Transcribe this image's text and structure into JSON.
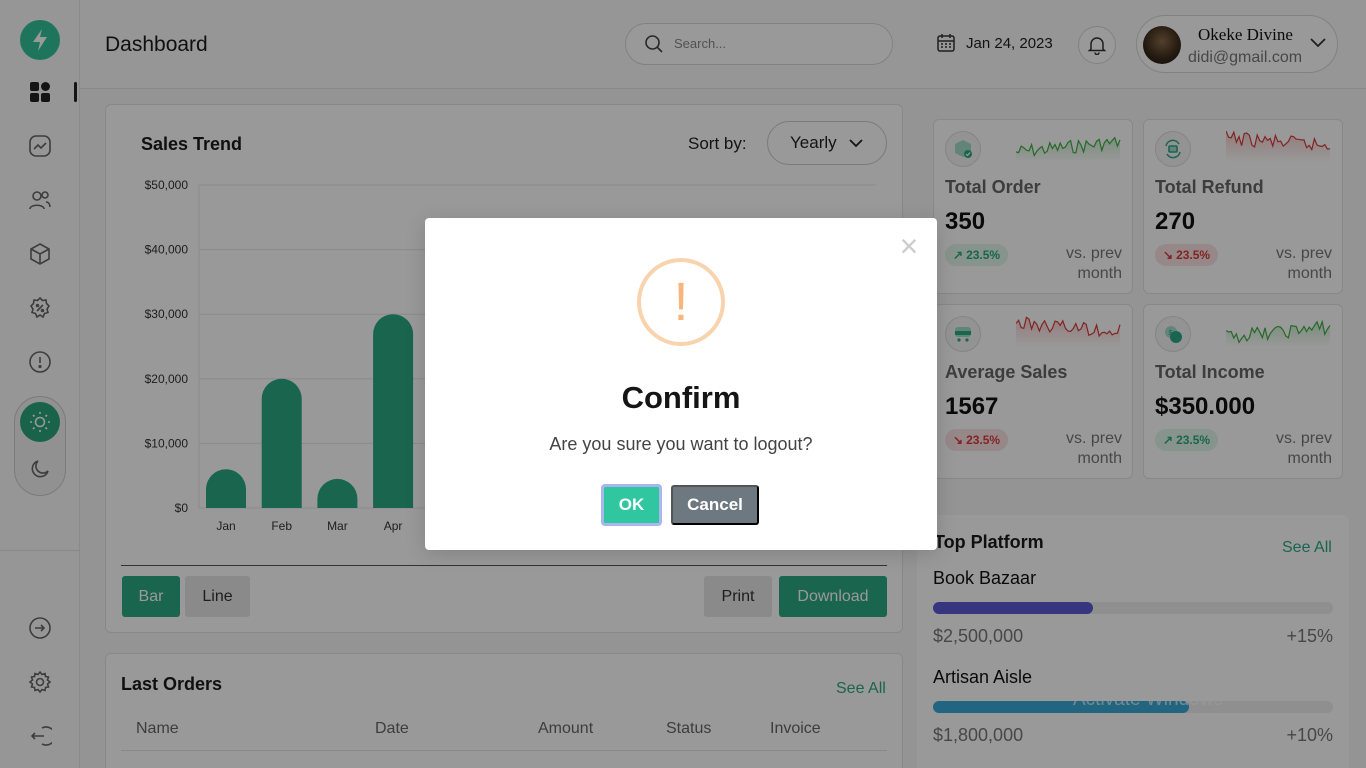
{
  "header": {
    "title": "Dashboard",
    "search_placeholder": "Search...",
    "date": "Jan 24, 2023",
    "user_name": "Okeke Divine",
    "user_email": "didi@gmail.com"
  },
  "sidebar": {
    "items": [
      "lightning-logo",
      "grid-icon",
      "trend-icon",
      "users-icon",
      "box-icon",
      "discount-icon",
      "info-icon"
    ],
    "mode_active": "light",
    "bottom_items": [
      "arrow-right-icon",
      "settings-icon",
      "logout-icon"
    ]
  },
  "sales_trend": {
    "title": "Sales Trend",
    "sort_label": "Sort by:",
    "sort_value": "Yearly",
    "buttons": {
      "bar": "Bar",
      "line": "Line",
      "print": "Print",
      "download": "Download"
    }
  },
  "chart_data": {
    "type": "bar",
    "categories": [
      "Jan",
      "Feb",
      "Mar",
      "Apr"
    ],
    "values": [
      6000,
      20000,
      4500,
      30000
    ],
    "ylim": [
      0,
      50000
    ],
    "yticks": [
      "$0",
      "$10,000",
      "$20,000",
      "$30,000",
      "$40,000",
      "$50,000"
    ],
    "color": "#2ba882"
  },
  "last_orders": {
    "title": "Last Orders",
    "see_all": "See All",
    "columns": [
      "Name",
      "Date",
      "Amount",
      "Status",
      "Invoice"
    ]
  },
  "stats": [
    {
      "label": "Total Order",
      "value": "350",
      "change": "23.5%",
      "trend": "up",
      "vs": "vs. prev month",
      "spark_color": "#3cb043"
    },
    {
      "label": "Total Refund",
      "value": "270",
      "change": "23.5%",
      "trend": "down",
      "vs": "vs. prev month",
      "spark_color": "#d93b3b"
    },
    {
      "label": "Average Sales",
      "value": "1567",
      "change": "23.5%",
      "trend": "down",
      "vs": "vs. prev month",
      "spark_color": "#d93b3b"
    },
    {
      "label": "Total Income",
      "value": "$350.000",
      "change": "23.5%",
      "trend": "up",
      "vs": "vs. prev month",
      "spark_color": "#3cb043"
    }
  ],
  "top_platform": {
    "title": "Top Platform",
    "see_all": "See All",
    "items": [
      {
        "name": "Book Bazaar",
        "amount": "$2,500,000",
        "change": "+15%",
        "progress": 0.4,
        "color": "#5b5bd6"
      },
      {
        "name": "Artisan Aisle",
        "amount": "$1,800,000",
        "change": "+10%",
        "progress": 0.64,
        "color": "#3aa8d8"
      }
    ]
  },
  "watermark": {
    "line1": "Activate Windows",
    "line2": "Go to Settings to activate Windows."
  },
  "modal": {
    "icon": "!",
    "title": "Confirm",
    "message": "Are you sure you want to logout?",
    "ok": "OK",
    "cancel": "Cancel",
    "close": "×"
  }
}
